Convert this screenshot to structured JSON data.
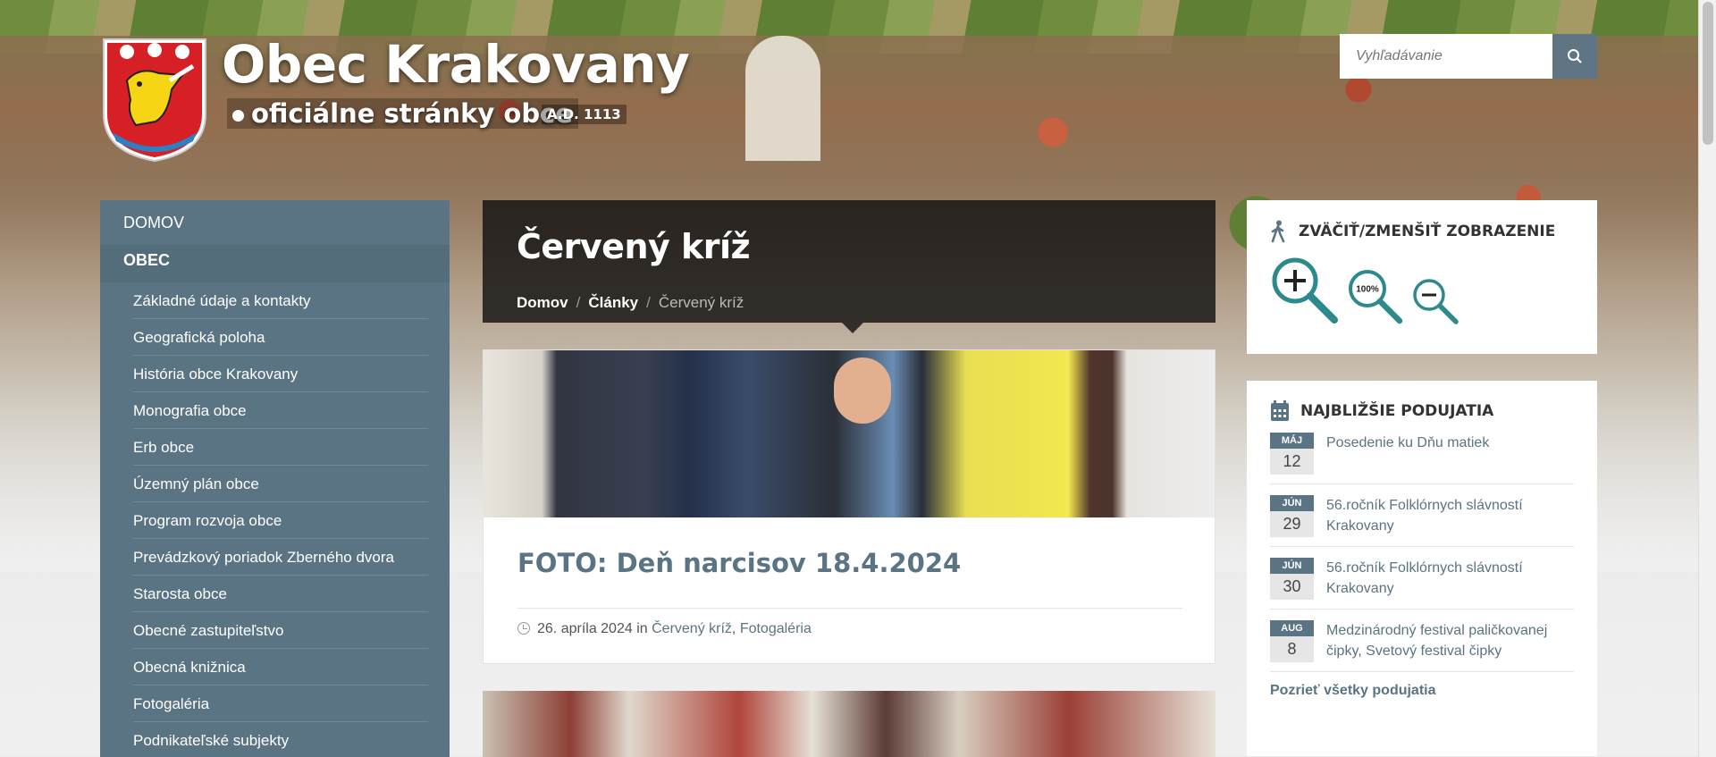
{
  "header": {
    "site_title": "Obec Krakovany",
    "site_subtitle": "oficiálne stránky obce",
    "site_year": "A.D. 1113",
    "search_placeholder": "Vyhľadávanie"
  },
  "sidebar": {
    "main_items": [
      {
        "label": "DOMOV",
        "active": false
      },
      {
        "label": "OBEC",
        "active": true
      }
    ],
    "sub_items": [
      "Základné údaje a kontakty",
      "Geografická poloha",
      "História obce Krakovany",
      "Monografia obce",
      "Erb obce",
      "Územný plán obce",
      "Program rozvoja obce",
      "Prevádzkový poriadok Zberného dvora",
      "Starosta obce",
      "Obecné zastupiteľstvo",
      "Obecná knižnica",
      "Fotogaléria",
      "Podnikateľské subjekty"
    ]
  },
  "page": {
    "title": "Červený kríž",
    "breadcrumb": [
      "Domov",
      "Články",
      "Červený kríž"
    ]
  },
  "article": {
    "title": "FOTO: Deň narcisov 18.4.2024",
    "date": "26. apríla 2024",
    "in": "in",
    "categories": [
      "Červený kríž",
      "Fotogaléria"
    ],
    "category_sep": ","
  },
  "zoom_widget": {
    "title": "ZVÄČIŤ/ZMENŠIŤ ZOBRAZENIE",
    "reset_label": "100%"
  },
  "events_widget": {
    "title": "NAJBLIŽŠIE PODUJATIA",
    "events": [
      {
        "month": "MÁJ",
        "day": "12",
        "name": "Posedenie ku Dňu matiek"
      },
      {
        "month": "JÚN",
        "day": "29",
        "name": "56.ročník Folklórnych slávností Krakovany"
      },
      {
        "month": "JÚN",
        "day": "30",
        "name": "56.ročník Folklórnych slávností Krakovany"
      },
      {
        "month": "AUG",
        "day": "8",
        "name": "Medzinárodný festival paličkovanej čipky, Svetový festival čipky"
      }
    ],
    "all_link": "Pozrieť všetky podujatia"
  },
  "colors": {
    "accent": "#5a7483",
    "zoom_icon": "#2d8a8c",
    "title_bg": "#0f0f0f"
  }
}
